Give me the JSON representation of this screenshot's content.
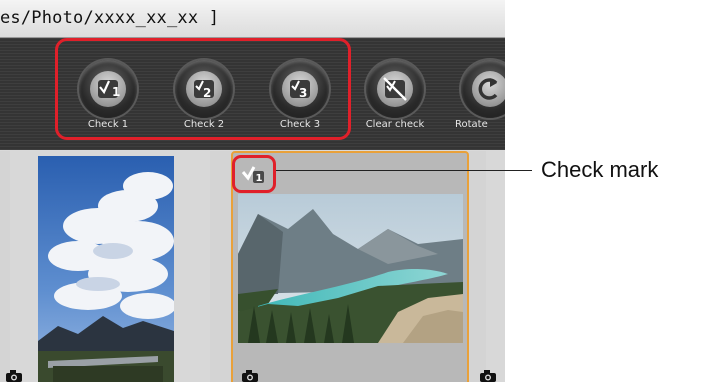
{
  "path_bar": {
    "text": "es/Photo/xxxx_xx_xx ]"
  },
  "toolbar": {
    "buttons": [
      {
        "label": "Check 1",
        "icon": "check-1-icon"
      },
      {
        "label": "Check 2",
        "icon": "check-2-icon"
      },
      {
        "label": "Check 3",
        "icon": "check-3-icon"
      },
      {
        "label": "Clear check",
        "icon": "clear-check-icon"
      },
      {
        "label": "Rotate",
        "icon": "rotate-icon"
      }
    ]
  },
  "thumbnails": [
    {
      "name": "sky-photo",
      "selected": false
    },
    {
      "name": "lake-photo",
      "selected": true,
      "check_mark": "1"
    }
  ],
  "callout": {
    "label": "Check mark"
  },
  "colors": {
    "highlight_red": "#e0202a",
    "selection_orange": "#e9a13a",
    "toolbar_dark": "#383838"
  }
}
